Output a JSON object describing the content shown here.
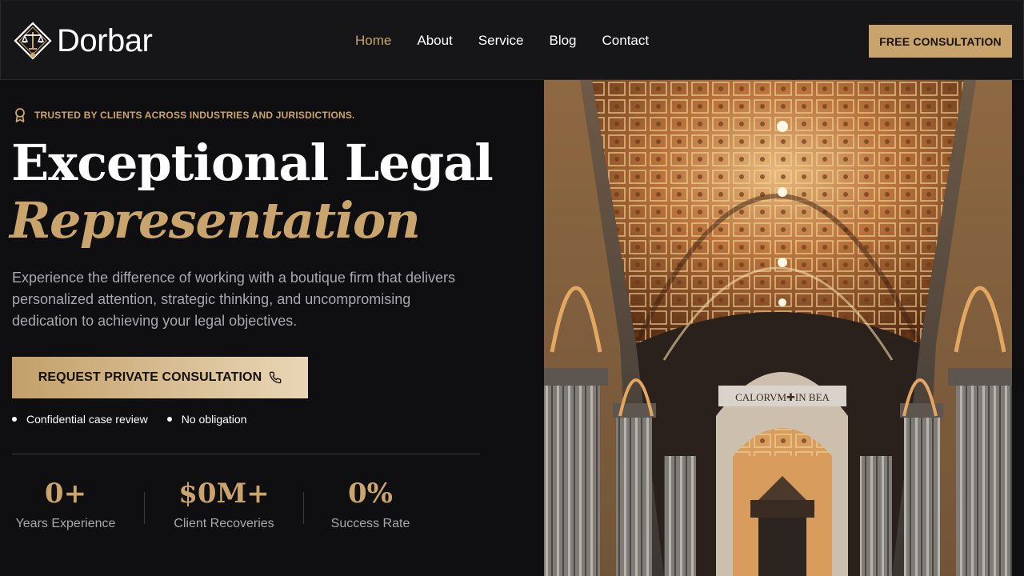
{
  "brand": {
    "name": "Dorbar"
  },
  "nav": {
    "items": [
      {
        "label": "Home",
        "active": true
      },
      {
        "label": "About"
      },
      {
        "label": "Service"
      },
      {
        "label": "Blog"
      },
      {
        "label": "Contact"
      }
    ],
    "cta_label": "FREE CONSULTATION"
  },
  "hero": {
    "eyebrow": "TRUSTED BY CLIENTS ACROSS INDUSTRIES AND JURISDICTIONS.",
    "title_line1": "Exceptional Legal",
    "title_line2": "Representation",
    "lead": "Experience the difference of working with a boutique firm that delivers personalized attention, strategic thinking, and uncompromising dedication to achieving your legal objectives.",
    "cta_label": "REQUEST PRIVATE CONSULTATION",
    "bullets": [
      "Confidential case review",
      "No obligation"
    ],
    "image_inscription": "CALORVM✚IN BEA",
    "stats": [
      {
        "value": "0+",
        "label": "Years Experience"
      },
      {
        "value": "$0M+",
        "label": "Client Recoveries"
      },
      {
        "value": "0%",
        "label": "Success Rate"
      }
    ]
  },
  "colors": {
    "accent": "#c9a46d",
    "background": "#0f0e10",
    "header": "#161517"
  },
  "icons": [
    "scales-logo-icon",
    "award-ribbon-icon",
    "phone-icon"
  ]
}
